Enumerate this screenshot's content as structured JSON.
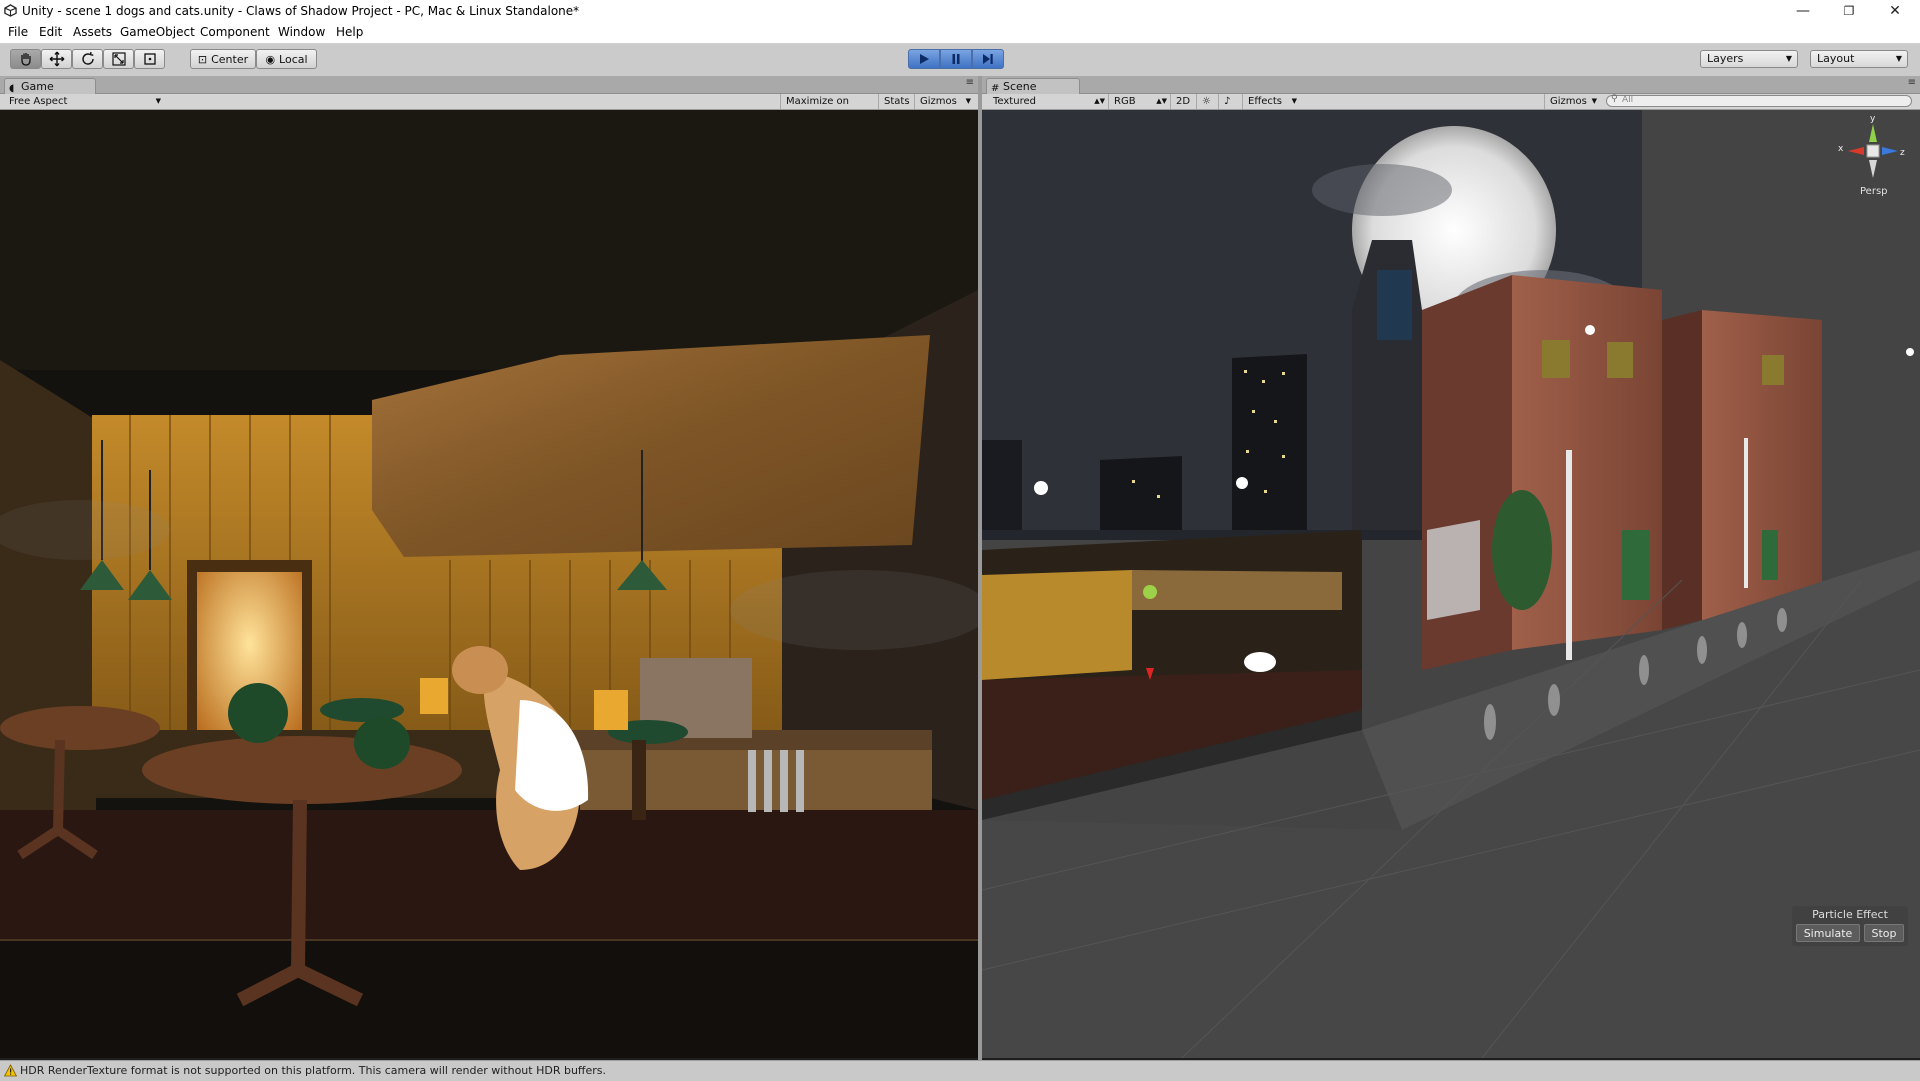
{
  "window": {
    "title": "Unity - scene 1 dogs and cats.unity - Claws of Shadow  Project - PC, Mac & Linux Standalone*",
    "minimize": "—",
    "restore": "❐",
    "close": "✕"
  },
  "menu": [
    "File",
    "Edit",
    "Assets",
    "GameObject",
    "Component",
    "Window",
    "Help"
  ],
  "toolbar": {
    "tools": [
      "hand-tool",
      "move-tool",
      "rotate-tool",
      "scale-tool",
      "rect-tool"
    ],
    "pivot": "Center",
    "space": "Local",
    "play_state": "playing",
    "layers": "Layers",
    "layout": "Layout"
  },
  "game_panel": {
    "tab": "Game",
    "aspect": "Free Aspect",
    "maximize": "Maximize on Play",
    "stats": "Stats",
    "gizmos": "Gizmos"
  },
  "scene_panel": {
    "tab": "Scene",
    "shading": "Textured",
    "channel": "RGB",
    "mode2d": "2D",
    "effects": "Effects",
    "gizmos": "Gizmos",
    "search": "All",
    "projection": "Persp",
    "axis_labels": {
      "x": "x",
      "y": "y",
      "z": "z"
    }
  },
  "particle_effect": {
    "title": "Particle Effect",
    "simulate": "Simulate",
    "stop": "Stop"
  },
  "status": {
    "message": "HDR RenderTexture format is not supported on this platform. This camera will render without HDR buffers."
  },
  "colors": {
    "play_blue": "#3f72c4",
    "panel_gray": "#c2c2c2",
    "warning_yellow": "#f2c200"
  }
}
